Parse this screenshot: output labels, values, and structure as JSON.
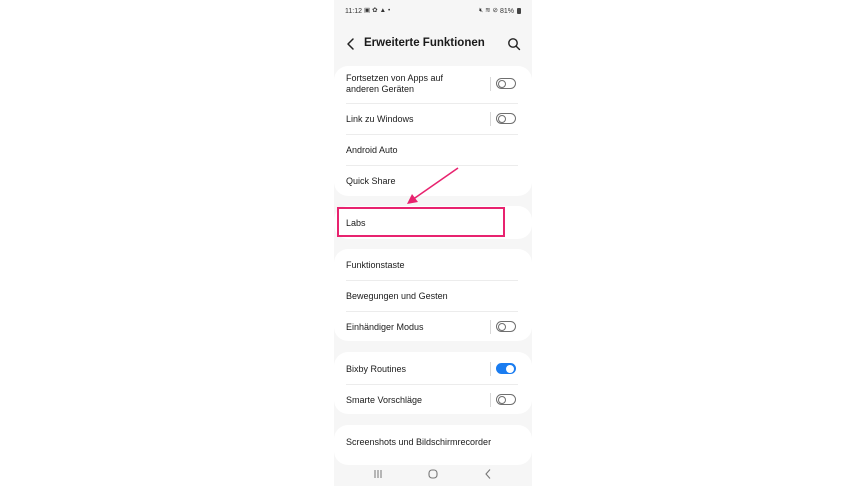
{
  "status_bar": {
    "time": "11:12",
    "left_icons": [
      "gallery-icon",
      "gear-icon",
      "warning-icon",
      "dot-icon"
    ],
    "right_icons": [
      "mute-icon",
      "wifi-icon",
      "dnd-icon"
    ],
    "battery": "81%"
  },
  "header": {
    "title": "Erweiterte Funktionen",
    "back_icon": "back-arrow-icon",
    "search_icon": "search-icon"
  },
  "groups": [
    {
      "items": [
        {
          "label": "Fortsetzen von Apps auf anderen Geräten",
          "toggle": false
        },
        {
          "label": "Link zu Windows",
          "toggle": false
        },
        {
          "label": "Android Auto"
        },
        {
          "label": "Quick Share"
        }
      ]
    },
    {
      "items": [
        {
          "label": "Labs"
        }
      ]
    },
    {
      "items": [
        {
          "label": "Funktionstaste"
        },
        {
          "label": "Bewegungen und Gesten"
        },
        {
          "label": "Einhändiger Modus",
          "toggle": false
        }
      ]
    },
    {
      "items": [
        {
          "label": "Bixby Routines",
          "toggle": true
        },
        {
          "label": "Smarte Vorschläge",
          "toggle": false
        }
      ]
    },
    {
      "items": [
        {
          "label": "Screenshots und Bildschirmrecorder"
        }
      ]
    }
  ],
  "annotation": {
    "highlight_color": "#e8236f",
    "target": "Labs"
  },
  "colors": {
    "toggle_on": "#1a7cf0",
    "background": "#f6f6f6",
    "card": "#ffffff"
  },
  "nav_bar": [
    "recent-apps-icon",
    "home-icon",
    "back-icon"
  ]
}
